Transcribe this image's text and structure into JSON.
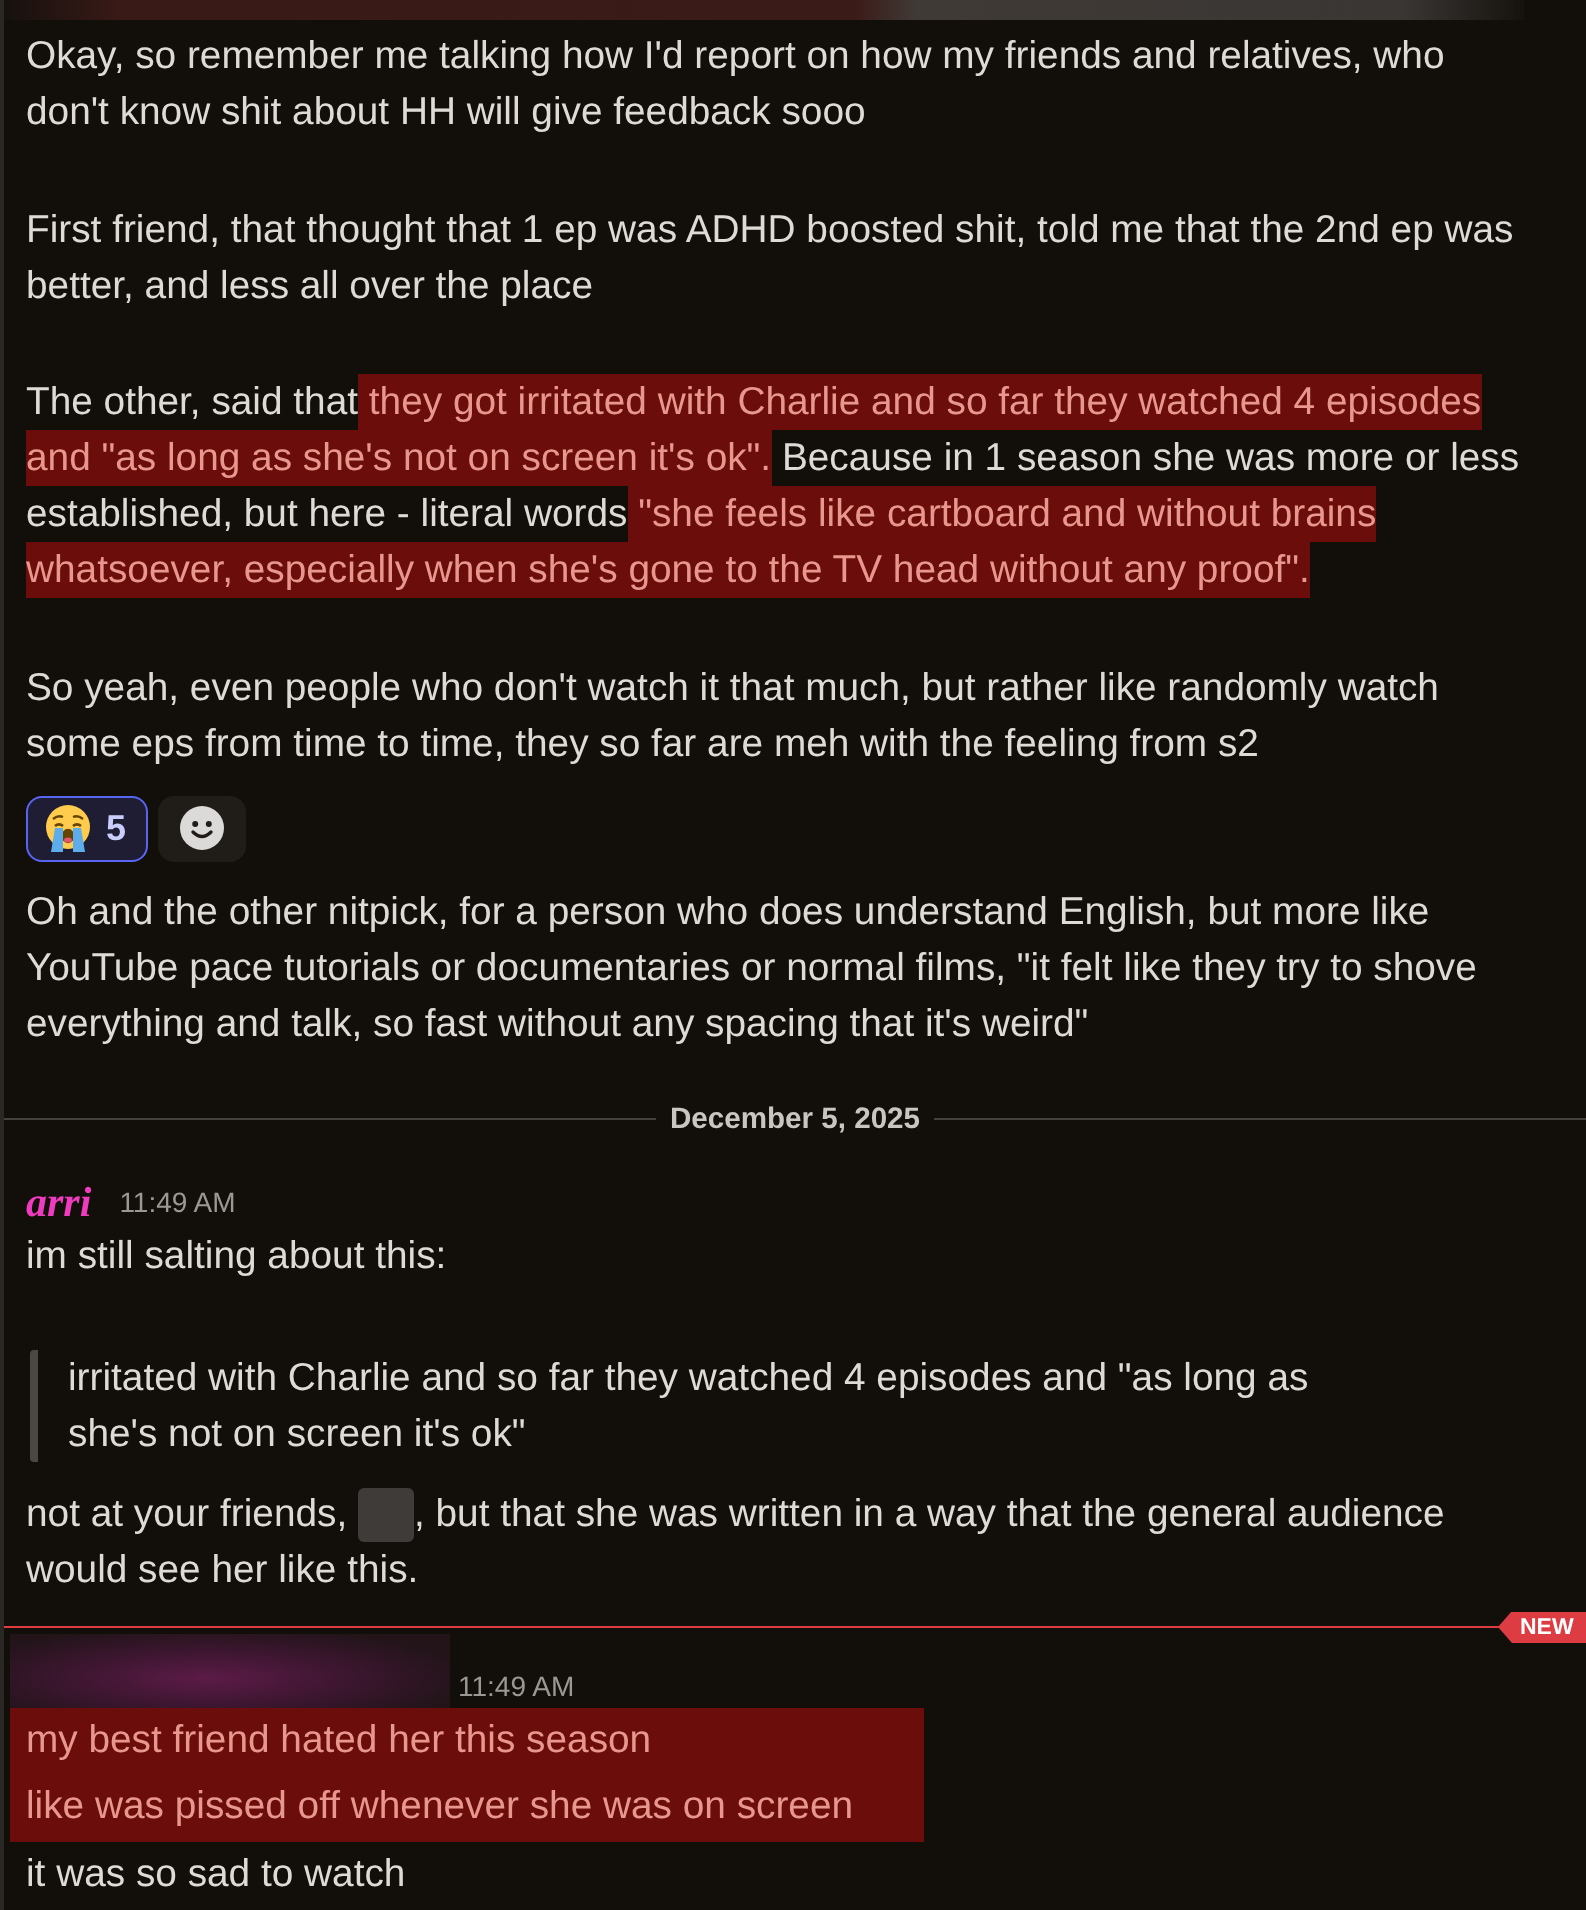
{
  "feed": [
    {
      "kind": "message",
      "cropped": true,
      "author": {
        "redacted": true
      },
      "blocks": [
        {
          "kind": "text",
          "paragraphs": [
            [
              {
                "kind": "plain",
                "text": "Okay, so remember me talking how I'd report on how my friends and relatives, who don't know shit about HH will give feedback sooo"
              }
            ],
            [
              {
                "kind": "plain",
                "text": "First friend, that thought that 1 ep was ADHD boosted shit, told me that the 2nd ep was better, and less all over the place"
              }
            ],
            [
              {
                "kind": "plain",
                "text": "The other, said that"
              },
              {
                "kind": "highlight",
                "text": " they got irritated with Charlie and so far they watched 4 episodes and \"as long as she's not on screen it's ok\"."
              },
              {
                "kind": "plain",
                "text": " Because in 1 season she was more or less established, but here - literal words"
              },
              {
                "kind": "highlight",
                "text": " \"she feels like cartboard and without brains whatsoever, especially when she's gone to the TV head without any proof\"."
              }
            ],
            [
              {
                "kind": "plain",
                "text": "So yeah, even people who don't watch it that much, but rather like randomly watch some eps from time to time, they so far are meh with the feeling from s2"
              }
            ]
          ]
        },
        {
          "kind": "reactions",
          "items": [
            {
              "count": "5",
              "selected": true
            }
          ]
        },
        {
          "kind": "text",
          "paragraphs": [
            [
              {
                "kind": "plain",
                "text": "Oh and the other nitpick, for a person who does understand English, but more like YouTube pace tutorials or documentaries or normal films, \"it felt like they try to shove everything and talk, so fast without any spacing that it's weird\""
              }
            ]
          ]
        }
      ]
    },
    {
      "kind": "date_divider",
      "label": "December 5, 2025"
    },
    {
      "kind": "message",
      "cropped": false,
      "author": {
        "redacted": false,
        "name": "arri"
      },
      "time": "11:49 AM",
      "blocks": [
        {
          "kind": "text",
          "paragraphs": [
            [
              {
                "kind": "plain",
                "text": "im still salting about this:"
              }
            ]
          ]
        },
        {
          "kind": "quote",
          "text": "irritated with Charlie and so far they watched 4 episodes and \"as long as she's not on screen it's ok\""
        },
        {
          "kind": "text",
          "paragraphs": [
            [
              {
                "kind": "plain",
                "text": "not at your friends, "
              },
              {
                "kind": "redacted"
              },
              {
                "kind": "plain",
                "text": ", but that she was written in a way that the general audience would see her like this."
              }
            ]
          ]
        }
      ]
    },
    {
      "kind": "new_divider",
      "label": "NEW"
    },
    {
      "kind": "message",
      "cropped": false,
      "author": {
        "redacted": true
      },
      "time": "11:49 AM",
      "blocks": [
        {
          "kind": "lines",
          "lines": [
            {
              "text": "my best friend hated her this season",
              "highlighted": true
            },
            {
              "text": "like was pissed off whenever she was on screen",
              "highlighted": true
            },
            {
              "text": "it was so sad to watch",
              "highlighted": false
            }
          ]
        }
      ]
    }
  ]
}
